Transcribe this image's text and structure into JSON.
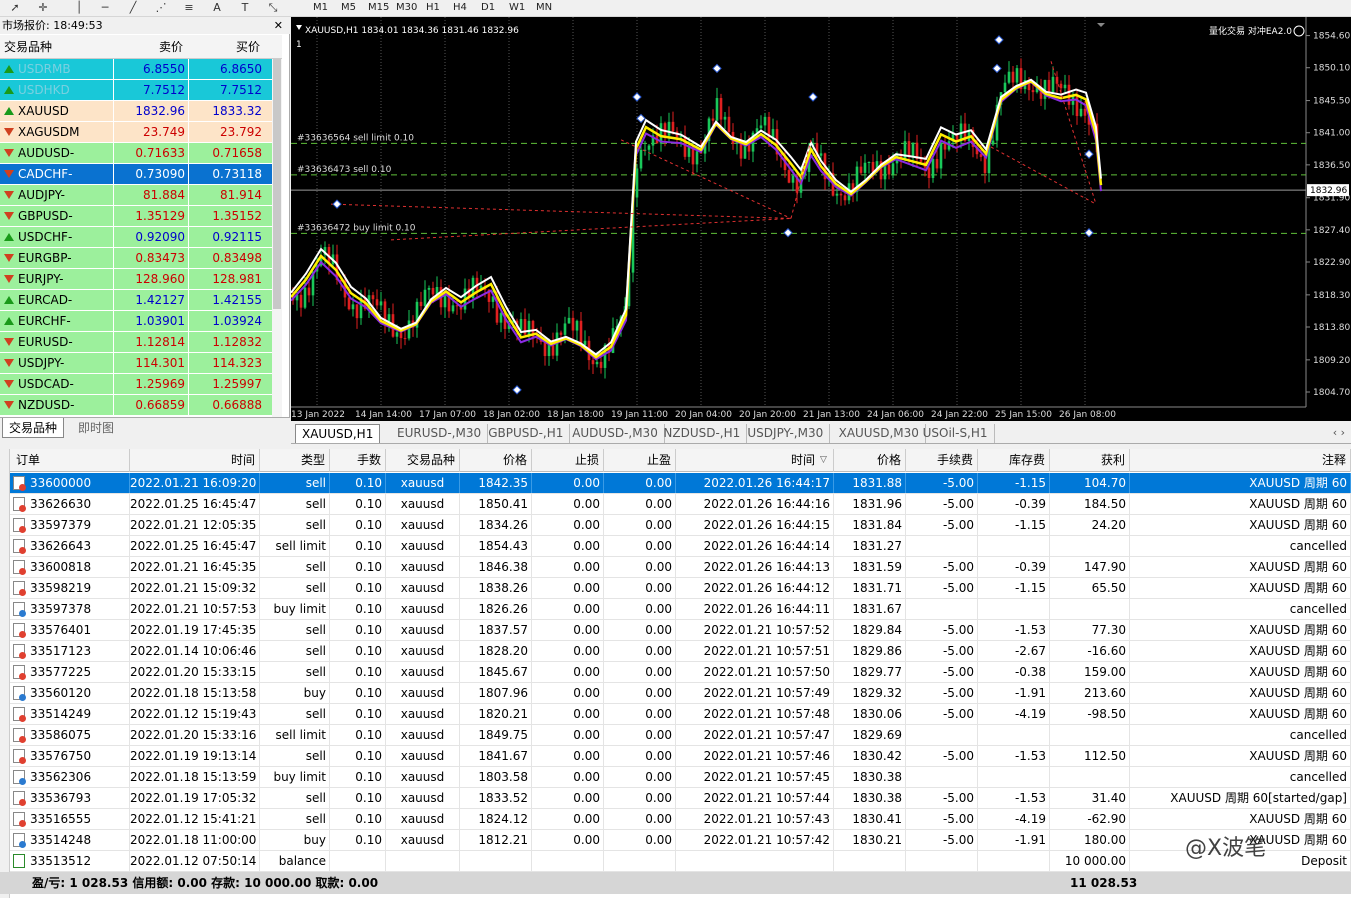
{
  "toolbar": {
    "timeframes": [
      "M1",
      "M5",
      "M15",
      "M30",
      "H1",
      "H4",
      "D1",
      "W1",
      "MN"
    ]
  },
  "market_watch": {
    "title": "市场报价: 18:49:53",
    "col_symbol": "交易品种",
    "col_bid": "卖价",
    "col_ask": "买价",
    "rows": [
      {
        "symbol": "USDRMB",
        "bid": "6.8550",
        "ask": "6.8650",
        "dir": "up",
        "bg": "#19c8d8",
        "fg": "#7ad0e0",
        "numfg": "#0000cc"
      },
      {
        "symbol": "USDHKD",
        "bid": "7.7512",
        "ask": "7.7512",
        "dir": "up",
        "bg": "#19c8d8",
        "fg": "#7ad0e0",
        "numfg": "#0000cc"
      },
      {
        "symbol": "XAUUSD",
        "bid": "1832.96",
        "ask": "1833.32",
        "dir": "up",
        "bg": "#fde4c8",
        "fg": "#000",
        "numfg": "#0000cc"
      },
      {
        "symbol": "XAGUSDM",
        "bid": "23.749",
        "ask": "23.792",
        "dir": "dn",
        "bg": "#fde4c8",
        "fg": "#000",
        "numfg": "#cc0000"
      },
      {
        "symbol": "AUDUSD-",
        "bid": "0.71633",
        "ask": "0.71658",
        "dir": "dn",
        "bg": "#9cf09c",
        "fg": "#000",
        "numfg": "#cc0000"
      },
      {
        "symbol": "CADCHF-",
        "bid": "0.73090",
        "ask": "0.73118",
        "dir": "dn",
        "bg": "#0a72d0",
        "fg": "#fff",
        "numfg": "#fff"
      },
      {
        "symbol": "AUDJPY-",
        "bid": "81.884",
        "ask": "81.914",
        "dir": "dn",
        "bg": "#9cf09c",
        "fg": "#000",
        "numfg": "#cc0000"
      },
      {
        "symbol": "GBPUSD-",
        "bid": "1.35129",
        "ask": "1.35152",
        "dir": "dn",
        "bg": "#9cf09c",
        "fg": "#000",
        "numfg": "#cc0000"
      },
      {
        "symbol": "USDCHF-",
        "bid": "0.92090",
        "ask": "0.92115",
        "dir": "up",
        "bg": "#9cf09c",
        "fg": "#000",
        "numfg": "#0000cc"
      },
      {
        "symbol": "EURGBP-",
        "bid": "0.83473",
        "ask": "0.83498",
        "dir": "dn",
        "bg": "#9cf09c",
        "fg": "#000",
        "numfg": "#cc0000"
      },
      {
        "symbol": "EURJPY-",
        "bid": "128.960",
        "ask": "128.981",
        "dir": "dn",
        "bg": "#9cf09c",
        "fg": "#000",
        "numfg": "#cc0000"
      },
      {
        "symbol": "EURCAD-",
        "bid": "1.42127",
        "ask": "1.42155",
        "dir": "up",
        "bg": "#9cf09c",
        "fg": "#000",
        "numfg": "#0000cc"
      },
      {
        "symbol": "EURCHF-",
        "bid": "1.03901",
        "ask": "1.03924",
        "dir": "up",
        "bg": "#9cf09c",
        "fg": "#000",
        "numfg": "#0000cc"
      },
      {
        "symbol": "EURUSD-",
        "bid": "1.12814",
        "ask": "1.12832",
        "dir": "dn",
        "bg": "#9cf09c",
        "fg": "#000",
        "numfg": "#cc0000"
      },
      {
        "symbol": "USDJPY-",
        "bid": "114.301",
        "ask": "114.323",
        "dir": "dn",
        "bg": "#9cf09c",
        "fg": "#000",
        "numfg": "#cc0000"
      },
      {
        "symbol": "USDCAD-",
        "bid": "1.25969",
        "ask": "1.25997",
        "dir": "dn",
        "bg": "#9cf09c",
        "fg": "#000",
        "numfg": "#cc0000"
      },
      {
        "symbol": "NZDUSD-",
        "bid": "0.66859",
        "ask": "0.66888",
        "dir": "dn",
        "bg": "#9cf09c",
        "fg": "#000",
        "numfg": "#cc0000"
      }
    ],
    "tab_symbols": "交易品种",
    "tab_ticks": "即时图"
  },
  "chart": {
    "header": "XAUUSD,H1  1834.01 1834.36 1831.46 1832.96",
    "ea_label": "量化交易 对冲EA2.0",
    "marker_1": "1",
    "price_ticks": [
      "1854.60",
      "1850.10",
      "1845.50",
      "1841.00",
      "1836.50",
      "1831.90",
      "1827.40",
      "1822.90",
      "1818.30",
      "1813.80",
      "1809.20",
      "1804.70"
    ],
    "current_price": "1832.96",
    "time_ticks": [
      "13 Jan 2022",
      "14 Jan 14:00",
      "17 Jan 07:00",
      "18 Jan 02:00",
      "18 Jan 18:00",
      "19 Jan 11:00",
      "20 Jan 04:00",
      "20 Jan 20:00",
      "21 Jan 13:00",
      "24 Jan 06:00",
      "24 Jan 22:00",
      "25 Jan 15:00",
      "26 Jan 08:00"
    ],
    "order_labels": [
      {
        "text": "#33636564 sell limit 0.10"
      },
      {
        "text": "#33636473 sell 0.10"
      },
      {
        "text": "#33636472 buy limit 0.10"
      }
    ],
    "tabs": [
      "XAUUSD,H1",
      "EURUSD-,M30",
      "GBPUSD-,H1",
      "AUDUSD-,M30",
      "NZDUSD-,H1",
      "USDJPY-,M30",
      "XAUUSD,M30",
      "USOil-S,H1"
    ]
  },
  "terminal": {
    "columns": [
      "订单",
      "时间",
      "类型",
      "手数",
      "交易品种",
      "价格",
      "止损",
      "止盈",
      "时间",
      "价格",
      "手续费",
      "库存费",
      "获利",
      "注释"
    ],
    "rows": [
      {
        "order": "33600000",
        "open_time": "2022.01.21 16:09:20",
        "type": "sell",
        "lots": "0.10",
        "symbol": "xauusd",
        "price": "1842.35",
        "sl": "0.00",
        "tp": "0.00",
        "close_time": "2022.01.26 16:44:17",
        "close_price": "1831.88",
        "commission": "-5.00",
        "swap": "-1.15",
        "profit": "104.70",
        "comment": "XAUUSD 周期 60",
        "icon": "red"
      },
      {
        "order": "33626630",
        "open_time": "2022.01.25 16:45:47",
        "type": "sell",
        "lots": "0.10",
        "symbol": "xauusd",
        "price": "1850.41",
        "sl": "0.00",
        "tp": "0.00",
        "close_time": "2022.01.26 16:44:16",
        "close_price": "1831.96",
        "commission": "-5.00",
        "swap": "-0.39",
        "profit": "184.50",
        "comment": "XAUUSD 周期 60",
        "icon": "red"
      },
      {
        "order": "33597379",
        "open_time": "2022.01.21 12:05:35",
        "type": "sell",
        "lots": "0.10",
        "symbol": "xauusd",
        "price": "1834.26",
        "sl": "0.00",
        "tp": "0.00",
        "close_time": "2022.01.26 16:44:15",
        "close_price": "1831.84",
        "commission": "-5.00",
        "swap": "-1.15",
        "profit": "24.20",
        "comment": "XAUUSD 周期 60",
        "icon": "red"
      },
      {
        "order": "33626643",
        "open_time": "2022.01.25 16:45:47",
        "type": "sell limit",
        "lots": "0.10",
        "symbol": "xauusd",
        "price": "1854.43",
        "sl": "0.00",
        "tp": "0.00",
        "close_time": "2022.01.26 16:44:14",
        "close_price": "1831.27",
        "commission": "",
        "swap": "",
        "profit": "",
        "comment": "cancelled",
        "icon": "red"
      },
      {
        "order": "33600818",
        "open_time": "2022.01.21 16:45:35",
        "type": "sell",
        "lots": "0.10",
        "symbol": "xauusd",
        "price": "1846.38",
        "sl": "0.00",
        "tp": "0.00",
        "close_time": "2022.01.26 16:44:13",
        "close_price": "1831.59",
        "commission": "-5.00",
        "swap": "-0.39",
        "profit": "147.90",
        "comment": "XAUUSD 周期 60",
        "icon": "red"
      },
      {
        "order": "33598219",
        "open_time": "2022.01.21 15:09:32",
        "type": "sell",
        "lots": "0.10",
        "symbol": "xauusd",
        "price": "1838.26",
        "sl": "0.00",
        "tp": "0.00",
        "close_time": "2022.01.26 16:44:12",
        "close_price": "1831.71",
        "commission": "-5.00",
        "swap": "-1.15",
        "profit": "65.50",
        "comment": "XAUUSD 周期 60",
        "icon": "red"
      },
      {
        "order": "33597378",
        "open_time": "2022.01.21 10:57:53",
        "type": "buy limit",
        "lots": "0.10",
        "symbol": "xauusd",
        "price": "1826.26",
        "sl": "0.00",
        "tp": "0.00",
        "close_time": "2022.01.26 16:44:11",
        "close_price": "1831.67",
        "commission": "",
        "swap": "",
        "profit": "",
        "comment": "cancelled",
        "icon": "blue"
      },
      {
        "order": "33576401",
        "open_time": "2022.01.19 17:45:35",
        "type": "sell",
        "lots": "0.10",
        "symbol": "xauusd",
        "price": "1837.57",
        "sl": "0.00",
        "tp": "0.00",
        "close_time": "2022.01.21 10:57:52",
        "close_price": "1829.84",
        "commission": "-5.00",
        "swap": "-1.53",
        "profit": "77.30",
        "comment": "XAUUSD 周期 60",
        "icon": "red"
      },
      {
        "order": "33517123",
        "open_time": "2022.01.14 10:06:46",
        "type": "sell",
        "lots": "0.10",
        "symbol": "xauusd",
        "price": "1828.20",
        "sl": "0.00",
        "tp": "0.00",
        "close_time": "2022.01.21 10:57:51",
        "close_price": "1829.86",
        "commission": "-5.00",
        "swap": "-2.67",
        "profit": "-16.60",
        "comment": "XAUUSD 周期 60",
        "icon": "red"
      },
      {
        "order": "33577225",
        "open_time": "2022.01.20 15:33:15",
        "type": "sell",
        "lots": "0.10",
        "symbol": "xauusd",
        "price": "1845.67",
        "sl": "0.00",
        "tp": "0.00",
        "close_time": "2022.01.21 10:57:50",
        "close_price": "1829.77",
        "commission": "-5.00",
        "swap": "-0.38",
        "profit": "159.00",
        "comment": "XAUUSD 周期 60",
        "icon": "red"
      },
      {
        "order": "33560120",
        "open_time": "2022.01.18 15:13:58",
        "type": "buy",
        "lots": "0.10",
        "symbol": "xauusd",
        "price": "1807.96",
        "sl": "0.00",
        "tp": "0.00",
        "close_time": "2022.01.21 10:57:49",
        "close_price": "1829.32",
        "commission": "-5.00",
        "swap": "-1.91",
        "profit": "213.60",
        "comment": "XAUUSD 周期 60",
        "icon": "blue"
      },
      {
        "order": "33514249",
        "open_time": "2022.01.12 15:19:43",
        "type": "sell",
        "lots": "0.10",
        "symbol": "xauusd",
        "price": "1820.21",
        "sl": "0.00",
        "tp": "0.00",
        "close_time": "2022.01.21 10:57:48",
        "close_price": "1830.06",
        "commission": "-5.00",
        "swap": "-4.19",
        "profit": "-98.50",
        "comment": "XAUUSD 周期 60",
        "icon": "red"
      },
      {
        "order": "33586075",
        "open_time": "2022.01.20 15:33:16",
        "type": "sell limit",
        "lots": "0.10",
        "symbol": "xauusd",
        "price": "1849.75",
        "sl": "0.00",
        "tp": "0.00",
        "close_time": "2022.01.21 10:57:47",
        "close_price": "1829.69",
        "commission": "",
        "swap": "",
        "profit": "",
        "comment": "cancelled",
        "icon": "red"
      },
      {
        "order": "33576750",
        "open_time": "2022.01.19 19:13:14",
        "type": "sell",
        "lots": "0.10",
        "symbol": "xauusd",
        "price": "1841.67",
        "sl": "0.00",
        "tp": "0.00",
        "close_time": "2022.01.21 10:57:46",
        "close_price": "1830.42",
        "commission": "-5.00",
        "swap": "-1.53",
        "profit": "112.50",
        "comment": "XAUUSD 周期 60",
        "icon": "red"
      },
      {
        "order": "33562306",
        "open_time": "2022.01.18 15:13:59",
        "type": "buy limit",
        "lots": "0.10",
        "symbol": "xauusd",
        "price": "1803.58",
        "sl": "0.00",
        "tp": "0.00",
        "close_time": "2022.01.21 10:57:45",
        "close_price": "1830.38",
        "commission": "",
        "swap": "",
        "profit": "",
        "comment": "cancelled",
        "icon": "blue"
      },
      {
        "order": "33536793",
        "open_time": "2022.01.19 17:05:32",
        "type": "sell",
        "lots": "0.10",
        "symbol": "xauusd",
        "price": "1833.52",
        "sl": "0.00",
        "tp": "0.00",
        "close_time": "2022.01.21 10:57:44",
        "close_price": "1830.38",
        "commission": "-5.00",
        "swap": "-1.53",
        "profit": "31.40",
        "comment": "XAUUSD 周期 60[started/gap]",
        "icon": "red"
      },
      {
        "order": "33516555",
        "open_time": "2022.01.12 15:41:21",
        "type": "sell",
        "lots": "0.10",
        "symbol": "xauusd",
        "price": "1824.12",
        "sl": "0.00",
        "tp": "0.00",
        "close_time": "2022.01.21 10:57:43",
        "close_price": "1830.41",
        "commission": "-5.00",
        "swap": "-4.19",
        "profit": "-62.90",
        "comment": "XAUUSD 周期 60",
        "icon": "red"
      },
      {
        "order": "33514248",
        "open_time": "2022.01.18 11:00:00",
        "type": "buy",
        "lots": "0.10",
        "symbol": "xauusd",
        "price": "1812.21",
        "sl": "0.00",
        "tp": "0.00",
        "close_time": "2022.01.21 10:57:42",
        "close_price": "1830.21",
        "commission": "-5.00",
        "swap": "-1.91",
        "profit": "180.00",
        "comment": "XAUUSD 周期 60",
        "icon": "blue"
      },
      {
        "order": "33513512",
        "open_time": "2022.01.12 07:50:14",
        "type": "balance",
        "lots": "",
        "symbol": "",
        "price": "",
        "sl": "",
        "tp": "",
        "close_time": "",
        "close_price": "",
        "commission": "",
        "swap": "",
        "profit": "10 000.00",
        "comment": "Deposit",
        "icon": "bal"
      }
    ],
    "summary_left": "盈/亏: 1 028.53  信用额: 0.00  存款: 10 000.00  取款: 0.00",
    "summary_total": "11 028.53"
  },
  "watermark": "@X波笔"
}
